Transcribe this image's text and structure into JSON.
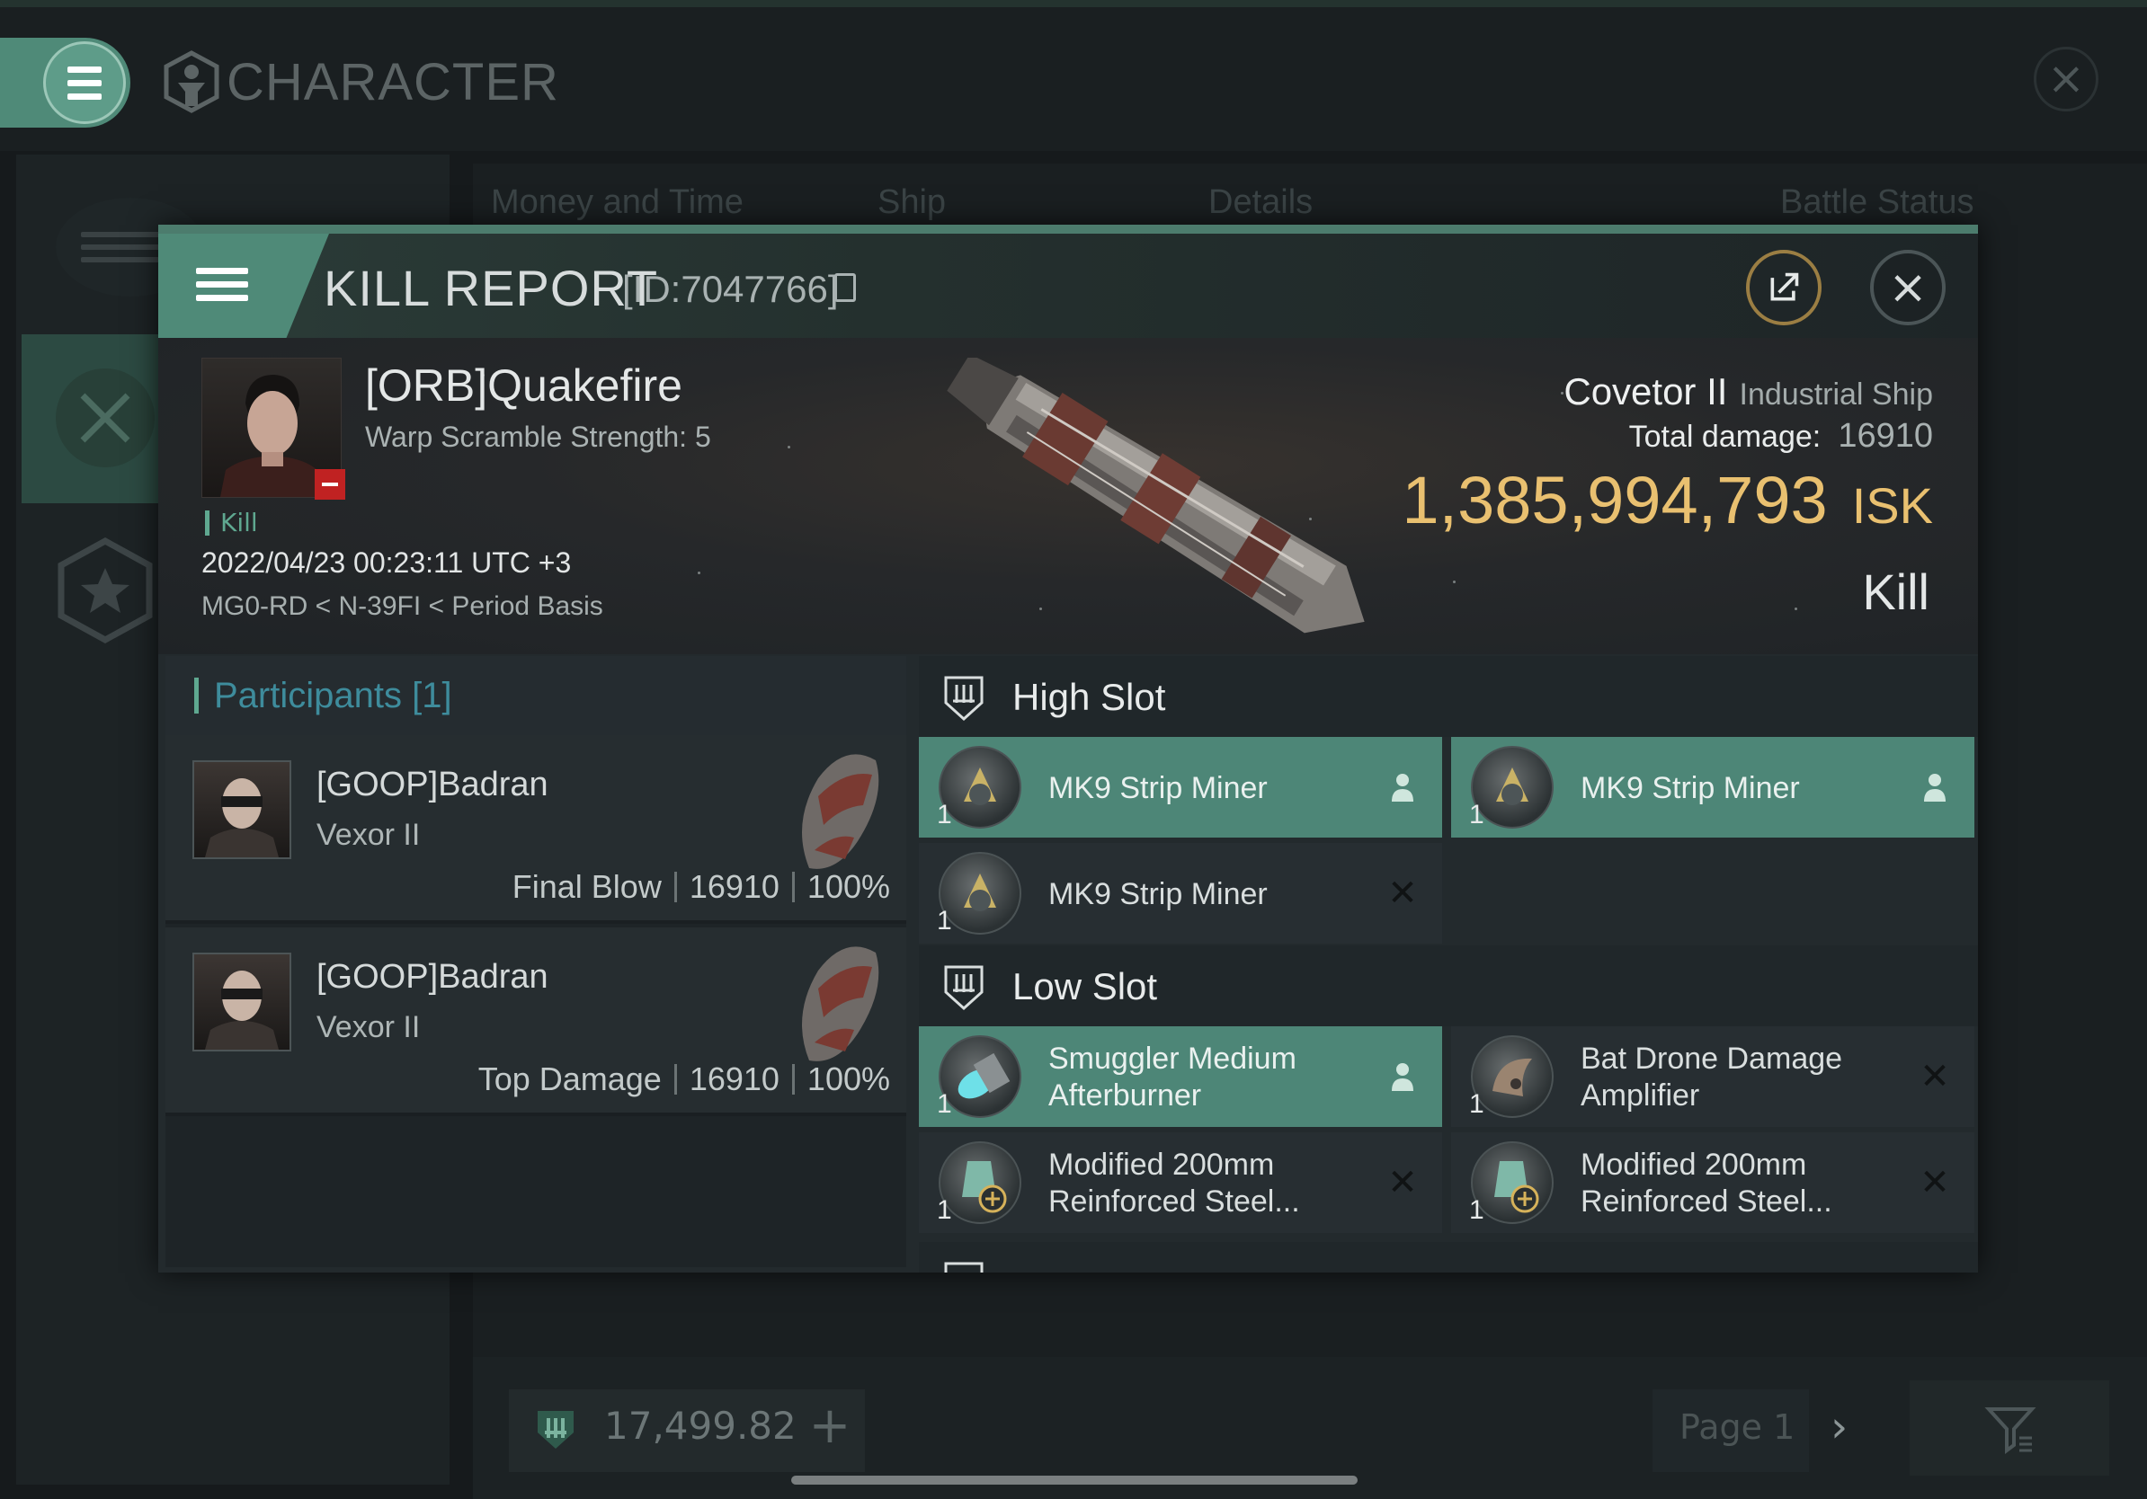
{
  "background": {
    "screen_title": "CHARACTER",
    "columns": [
      "Money and Time",
      "Ship",
      "Details",
      "Battle Status"
    ],
    "wallet": "17,499.82",
    "page": "Page 1"
  },
  "dialog": {
    "title": "KILL REPORT",
    "id": "[ID:7047766]"
  },
  "victim": {
    "name": "[ORB]Quakefire",
    "warp_scramble": "Warp Scramble Strength: 5",
    "tag": "Kill",
    "time": "2022/04/23 00:23:11 UTC +3",
    "location": "MG0-RD < N-39FI < Period Basis",
    "ship_name": "Covetor II",
    "ship_class": "Industrial Ship",
    "total_damage_label": "Total damage:",
    "total_damage": "16910",
    "isk_value": "1,385,994,793",
    "isk_unit": "ISK",
    "result": "Kill"
  },
  "participants": {
    "title": "Participants [1]",
    "rows": [
      {
        "name": "[GOOP]Badran",
        "ship": "Vexor II",
        "role": "Final Blow",
        "damage": "16910",
        "percent": "100%"
      },
      {
        "name": "[GOOP]Badran",
        "ship": "Vexor II",
        "role": "Top Damage",
        "damage": "16910",
        "percent": "100%"
      }
    ]
  },
  "fitting": {
    "high_slot": {
      "title": "High Slot",
      "modules": [
        {
          "name": "MK9 Strip Miner",
          "qty": "1",
          "status": "person-icon",
          "selected": true
        },
        {
          "name": "MK9 Strip Miner",
          "qty": "1",
          "status": "person-icon",
          "selected": true
        },
        {
          "name": "MK9 Strip Miner",
          "qty": "1",
          "status": "destroyed-x-icon",
          "selected": false
        }
      ]
    },
    "low_slot": {
      "title": "Low Slot",
      "modules": [
        {
          "name": "Smuggler Medium Afterburner",
          "qty": "1",
          "status": "person-icon",
          "selected": true
        },
        {
          "name": "Bat Drone Damage Amplifier",
          "qty": "1",
          "status": "destroyed-x-icon",
          "selected": false
        },
        {
          "name": "Modified 200mm Reinforced Steel...",
          "qty": "1",
          "status": "destroyed-x-icon",
          "selected": false
        },
        {
          "name": "Modified 200mm Reinforced Steel...",
          "qty": "1",
          "status": "destroyed-x-icon",
          "selected": false
        }
      ]
    }
  },
  "colors": {
    "accent": "#4f8a78",
    "isk": "#e9c070",
    "selected_row": "#4d8677",
    "panel": "#232a2d"
  }
}
